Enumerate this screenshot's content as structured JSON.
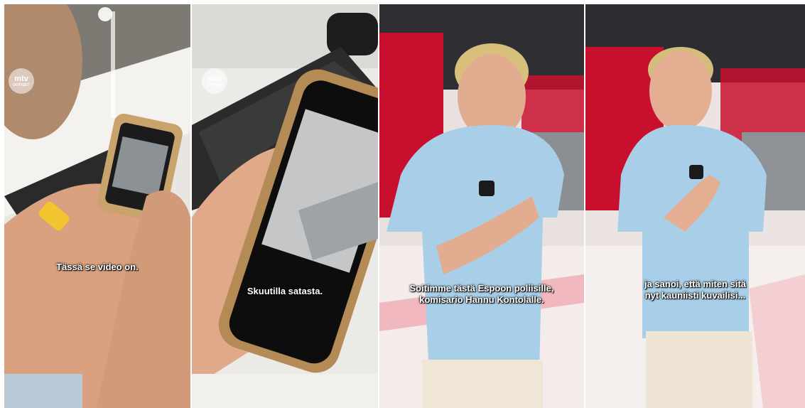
{
  "logo": {
    "main": "mtv",
    "sub": "UUTISET"
  },
  "panels": [
    {
      "caption": "Tässä se video on."
    },
    {
      "caption": "Skuutilla satasta."
    },
    {
      "caption": "Soitimme tästä Espoon poliisille,\nkomisario Hannu Kontolalle."
    },
    {
      "caption": "ja sanoi, että miten sitä\nnyt kauniisti kuvailisi..."
    }
  ],
  "colors": {
    "studio_red": "#c8102e",
    "polo_blue": "#a9cfe8",
    "phone_frame": "#c8a36b"
  }
}
